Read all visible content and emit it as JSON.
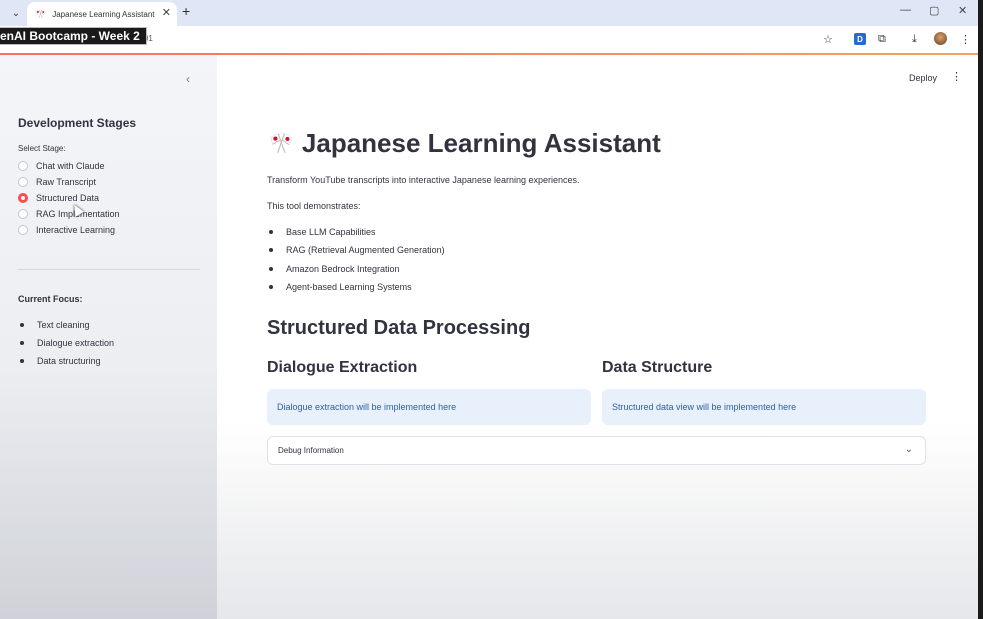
{
  "browser": {
    "tab_title": "Japanese Learning Assistant",
    "url_fragment": "8501",
    "overlay_label": "enAI Bootcamp - Week 2",
    "new_tab_symbol": "+",
    "close_symbol": "✕"
  },
  "app": {
    "deploy_label": "Deploy",
    "title": "Japanese Learning Assistant",
    "title_icon": "🎌",
    "intro": "Transform YouTube transcripts into interactive Japanese learning experiences.",
    "demo_intro": "This tool demonstrates:",
    "features": [
      "Base LLM Capabilities",
      "RAG (Retrieval Augmented Generation)",
      "Amazon Bedrock Integration",
      "Agent-based Learning Systems"
    ],
    "section_title": "Structured Data Processing",
    "col1_title": "Dialogue Extraction",
    "col1_info": "Dialogue extraction will be implemented here",
    "col2_title": "Data Structure",
    "col2_info": "Structured data view will be implemented here",
    "expander_label": "Debug Information"
  },
  "sidebar": {
    "heading": "Development Stages",
    "select_label": "Select Stage:",
    "stages": [
      "Chat with Claude",
      "Raw Transcript",
      "Structured Data",
      "RAG Implementation",
      "Interactive Learning"
    ],
    "selected_index": 2,
    "focus_heading": "Current Focus:",
    "focus_items": [
      "Text cleaning",
      "Dialogue extraction",
      "Data structuring"
    ]
  },
  "colors": {
    "accent": "#ff4b4b",
    "info_bg": "#e8f1fb",
    "info_text": "#2b5fa0"
  }
}
